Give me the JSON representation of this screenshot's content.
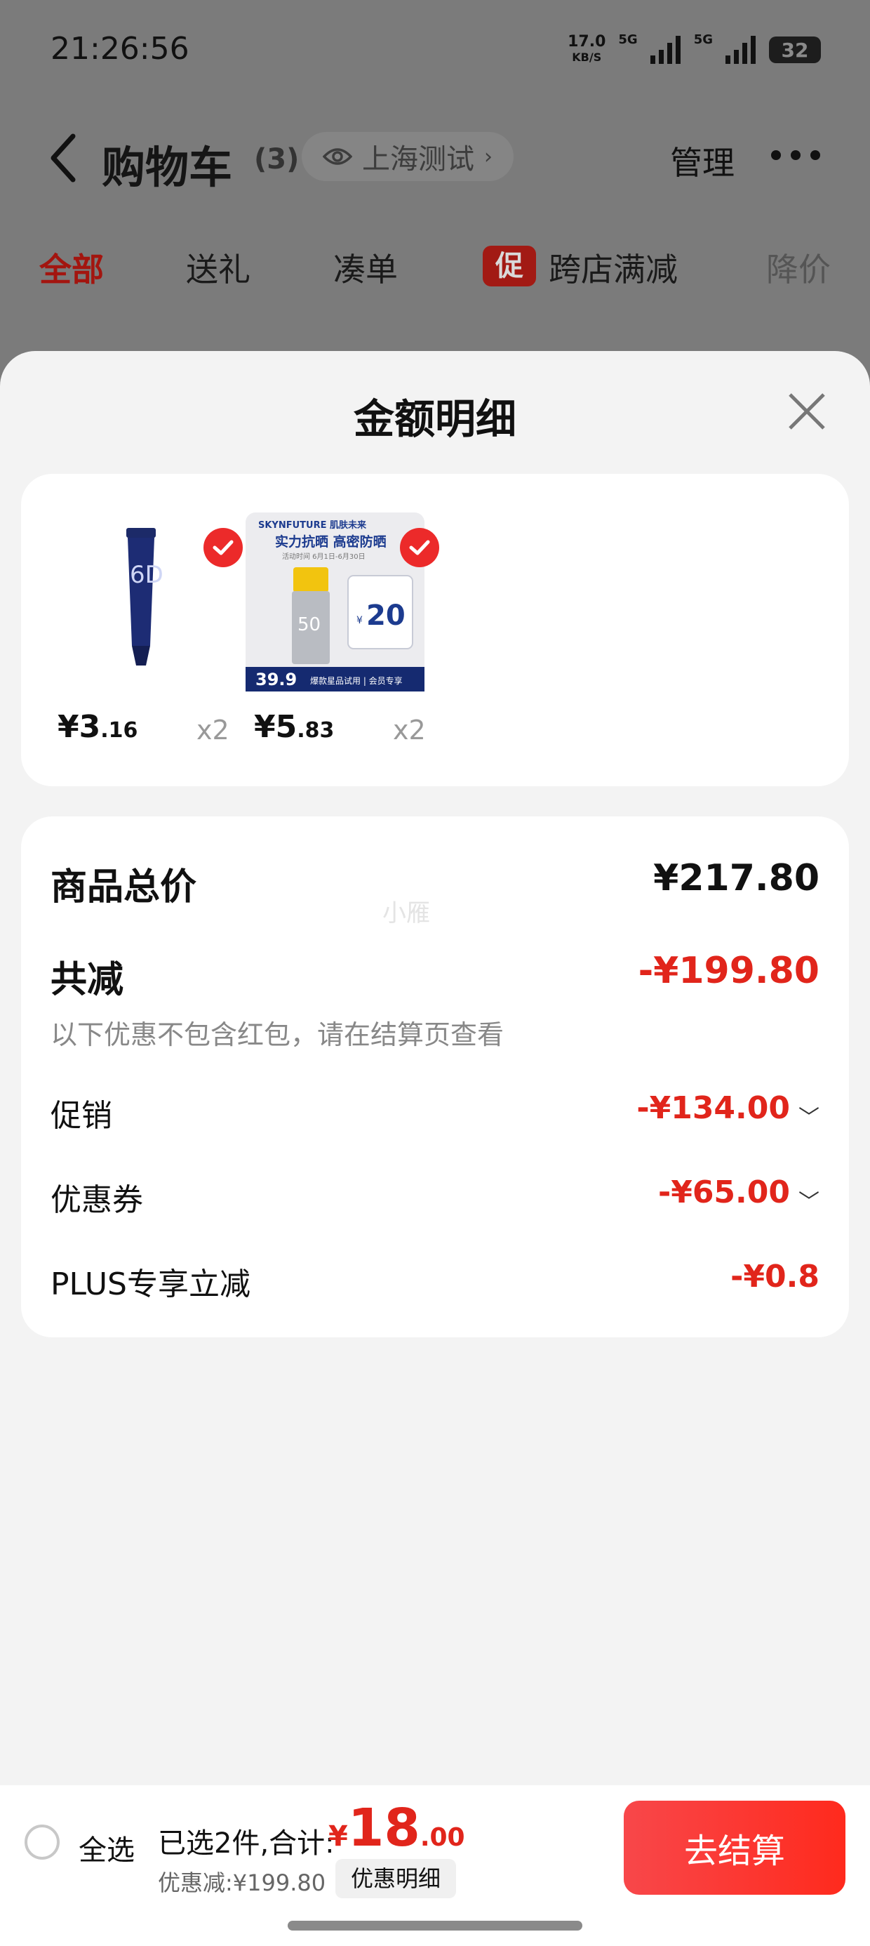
{
  "status_bar": {
    "time": "21:26:56",
    "net_speed": "17.0",
    "net_unit": "KB/S",
    "sim1": "5G",
    "sim2": "5G",
    "battery": "32"
  },
  "header": {
    "title": "购物车",
    "count": "(3)",
    "location": "上海测试",
    "manage": "管理"
  },
  "tabs": [
    {
      "label": "全部"
    },
    {
      "label": "送礼"
    },
    {
      "label": "凑单"
    },
    {
      "badge": "促",
      "label": "跨店满减"
    },
    {
      "label": "降价"
    }
  ],
  "sheet": {
    "title": "金额明细",
    "products": [
      {
        "price_int": "¥3",
        "price_dec": ".16",
        "qty": "x2",
        "image": "eye-cream-tube-image"
      },
      {
        "price_int": "¥5",
        "price_dec": ".83",
        "qty": "x2",
        "image": "sunscreen-promo-image",
        "img_brand": "SKYNFUTURE 肌肤未来",
        "img_headline": "实力抗晒 高密防晒",
        "img_date": "活动时间  6月1日-6月30日",
        "img_spf": "50",
        "img_coupon": "20",
        "img_price": "39.9",
        "img_footer": "爆款星品试用 | 会员专享"
      }
    ],
    "total_label": "商品总价",
    "total_value": "¥217.80",
    "watermark": "小雁",
    "discount_label": "共减",
    "discount_value": "-¥199.80",
    "discount_note": "以下优惠不包含红包，请在结算页查看",
    "lines": [
      {
        "label": "促销",
        "value": "-¥134.00",
        "expand": true
      },
      {
        "label": "优惠券",
        "value": "-¥65.00",
        "expand": true
      },
      {
        "label": "PLUS专享立减",
        "value": "-¥0.8",
        "expand": false
      }
    ]
  },
  "bottom_bar": {
    "select_all": "全选",
    "summary": "已选2件,合计:",
    "total_currency": "¥",
    "total_int": "18",
    "total_dec": ".00",
    "saving": "优惠减:¥199.80",
    "detail_button": "优惠明细",
    "checkout": "去结算"
  },
  "colors": {
    "accent": "#e1251b",
    "check": "#ec2a2a",
    "overlay": "#7b7b7b"
  }
}
